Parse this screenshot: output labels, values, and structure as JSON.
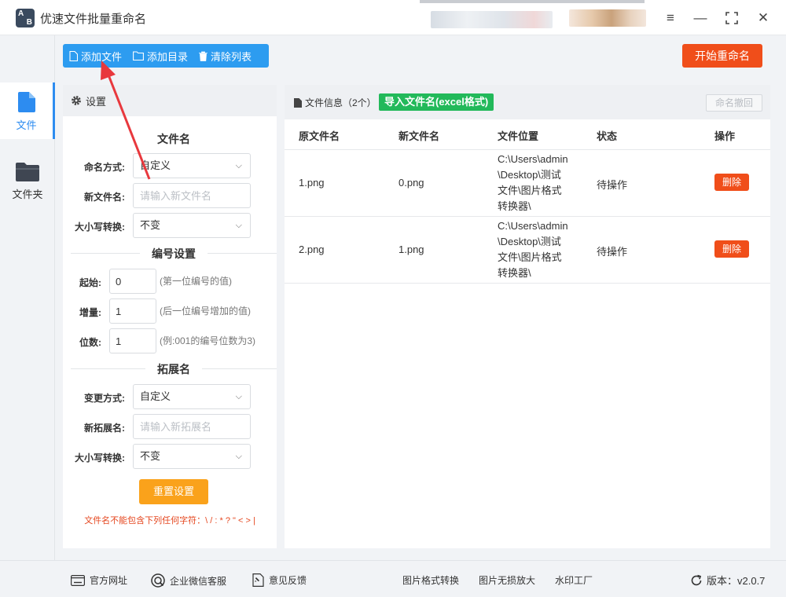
{
  "app": {
    "title": "优速文件批量重命名",
    "logo_text_top": "A",
    "logo_text_bottom": "B"
  },
  "window": {
    "menu": "≡",
    "minimize": "—",
    "maximize": "⛶",
    "close": "✕"
  },
  "nav": [
    {
      "label": "文件",
      "icon": "file-icon",
      "active": true
    },
    {
      "label": "文件夹",
      "icon": "folder-icon",
      "active": false
    }
  ],
  "toolbar": {
    "add_file": "添加文件",
    "add_dir": "添加目录",
    "clear_list": "清除列表",
    "start": "开始重命名"
  },
  "settings": {
    "header": "设置",
    "filename_section": "文件名",
    "naming_mode_label": "命名方式:",
    "naming_mode_value": "自定义",
    "new_name_label": "新文件名:",
    "new_name_placeholder": "请输入新文件名",
    "case_label": "大小写转换:",
    "case_value": "不变",
    "numbering_section": "编号设置",
    "start_label": "起始:",
    "start_value": "0",
    "start_hint": "(第一位编号的值)",
    "step_label": "增量:",
    "step_value": "1",
    "step_hint": "(后一位编号增加的值)",
    "digits_label": "位数:",
    "digits_value": "1",
    "digits_hint": "(例:001的编号位数为3)",
    "ext_section": "拓展名",
    "ext_mode_label": "变更方式:",
    "ext_mode_value": "自定义",
    "new_ext_label": "新拓展名:",
    "new_ext_placeholder": "请输入新拓展名",
    "ext_case_label": "大小写转换:",
    "ext_case_value": "不变",
    "reset": "重置设置",
    "warning": "文件名不能包含下列任何字符：\\ / : * ? \" < > |"
  },
  "files": {
    "title": "文件信息（2个）",
    "import": "导入文件名(excel格式)",
    "undo": "命名撤回",
    "columns": [
      "原文件名",
      "新文件名",
      "文件位置",
      "状态",
      "操作"
    ],
    "rows": [
      {
        "original": "1.png",
        "new": "0.png",
        "location": "C:\\Users\\admin\\Desktop\\测试文件\\图片格式转换器\\",
        "status": "待操作",
        "action": "删除"
      },
      {
        "original": "2.png",
        "new": "1.png",
        "location": "C:\\Users\\admin\\Desktop\\测试文件\\图片格式转换器\\",
        "status": "待操作",
        "action": "删除"
      }
    ]
  },
  "footer": {
    "website": "官方网址",
    "wechat": "企业微信客服",
    "feedback": "意见反馈",
    "img_convert": "图片格式转换",
    "img_enlarge": "图片无损放大",
    "watermark": "水印工厂",
    "version": "版本：v2.0.7"
  },
  "colors": {
    "primary": "#2d9cf0",
    "accent_orange": "#f04e1a",
    "green": "#22b95a",
    "reset_orange": "#faa21b"
  }
}
